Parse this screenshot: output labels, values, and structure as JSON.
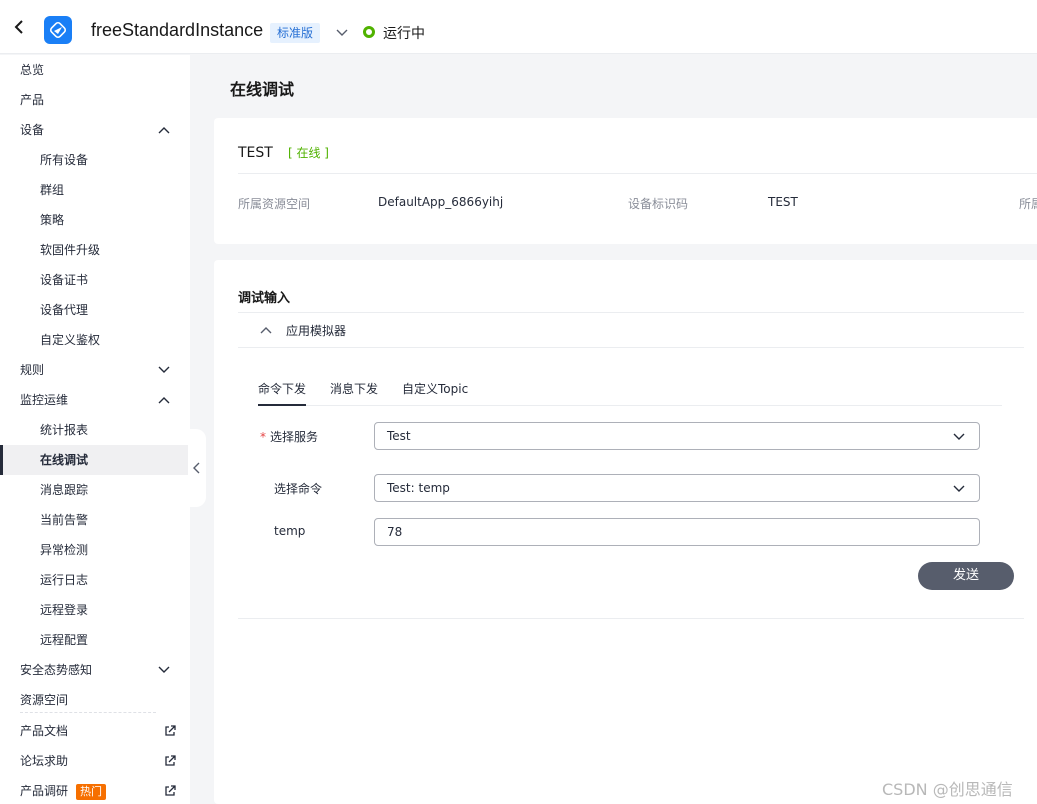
{
  "header": {
    "instance_name": "freeStandardInstance",
    "edition": "标准版",
    "status": "运行中",
    "status_color": "#50b200",
    "icons": [
      "back-icon",
      "app-logo-icon",
      "chevron-down-icon"
    ]
  },
  "sidebar": {
    "items": [
      {
        "label": "总览"
      },
      {
        "label": "产品"
      },
      {
        "label": "设备"
      },
      {
        "label": "所有设备"
      },
      {
        "label": "群组"
      },
      {
        "label": "策略"
      },
      {
        "label": "软固件升级"
      },
      {
        "label": "设备证书"
      },
      {
        "label": "设备代理"
      },
      {
        "label": "自定义鉴权"
      },
      {
        "label": "规则"
      },
      {
        "label": "监控运维"
      },
      {
        "label": "统计报表"
      },
      {
        "label": "在线调试"
      },
      {
        "label": "消息跟踪"
      },
      {
        "label": "当前告警"
      },
      {
        "label": "异常检测"
      },
      {
        "label": "运行日志"
      },
      {
        "label": "远程登录"
      },
      {
        "label": "远程配置"
      },
      {
        "label": "安全态势感知"
      },
      {
        "label": "资源空间"
      },
      {
        "label": "产品文档"
      },
      {
        "label": "论坛求助"
      },
      {
        "label": "产品调研"
      }
    ],
    "hot_badge": "热门"
  },
  "main": {
    "page_title": "在线调试",
    "device": {
      "name": "TEST",
      "online_status": "[ 在线 ]",
      "info": [
        {
          "label": "所属资源空间",
          "value": "DefaultApp_6866yihj"
        },
        {
          "label": "设备标识码",
          "value": "TEST"
        },
        {
          "label": "所属"
        }
      ]
    },
    "debug": {
      "section_title": "调试输入",
      "simulator_label": "应用模拟器",
      "tabs": [
        "命令下发",
        "消息下发",
        "自定义Topic"
      ],
      "active_tab": "命令下发",
      "form": {
        "service_label": "选择服务",
        "service_required": "*",
        "service_value": "Test",
        "command_label": "选择命令",
        "command_value": "Test: temp",
        "param_label": "temp",
        "param_value": "78"
      },
      "send_label": "发送"
    }
  },
  "watermark": "CSDN @创思通信",
  "colors": {
    "accent": "#1a7ff6",
    "online": "#50b200",
    "hot": "#f66f00",
    "button": "#575d6c",
    "required": "#e54545"
  }
}
